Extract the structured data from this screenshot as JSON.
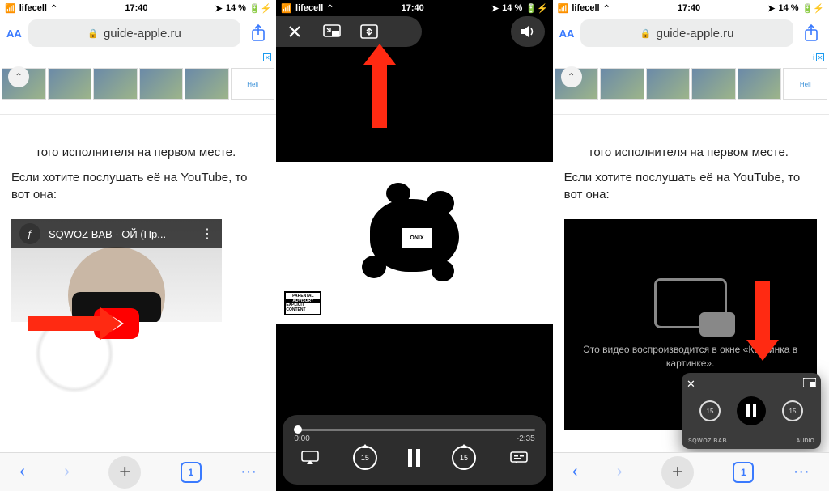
{
  "status": {
    "carrier": "lifecell",
    "time": "17:40",
    "battery": "14 %"
  },
  "safari": {
    "url": "guide-apple.ru",
    "tabs_count": "1"
  },
  "ad": {
    "info_label": "i",
    "logo_text": "Heli"
  },
  "article": {
    "line1_fragment": "того исполнителя на первом месте.",
    "line2": "Если хотите послушать её на YouTube, то вот она:"
  },
  "youtube": {
    "title": "SQWOZ BAB - ОЙ (Пр..."
  },
  "player": {
    "elapsed": "0:00",
    "remaining": "-2:35",
    "skip_seconds": "15",
    "splat_label": "ONIX",
    "parental": {
      "l1": "PARENTAL",
      "l2": "ADVISORY",
      "l3": "EXPLICIT CONTENT"
    }
  },
  "pip": {
    "message": "Это видео воспроизводится в окне «Картинка в картинке».",
    "skip_seconds": "15",
    "brand_left": "SQWOZ BAB",
    "brand_right": "AUDIO"
  }
}
